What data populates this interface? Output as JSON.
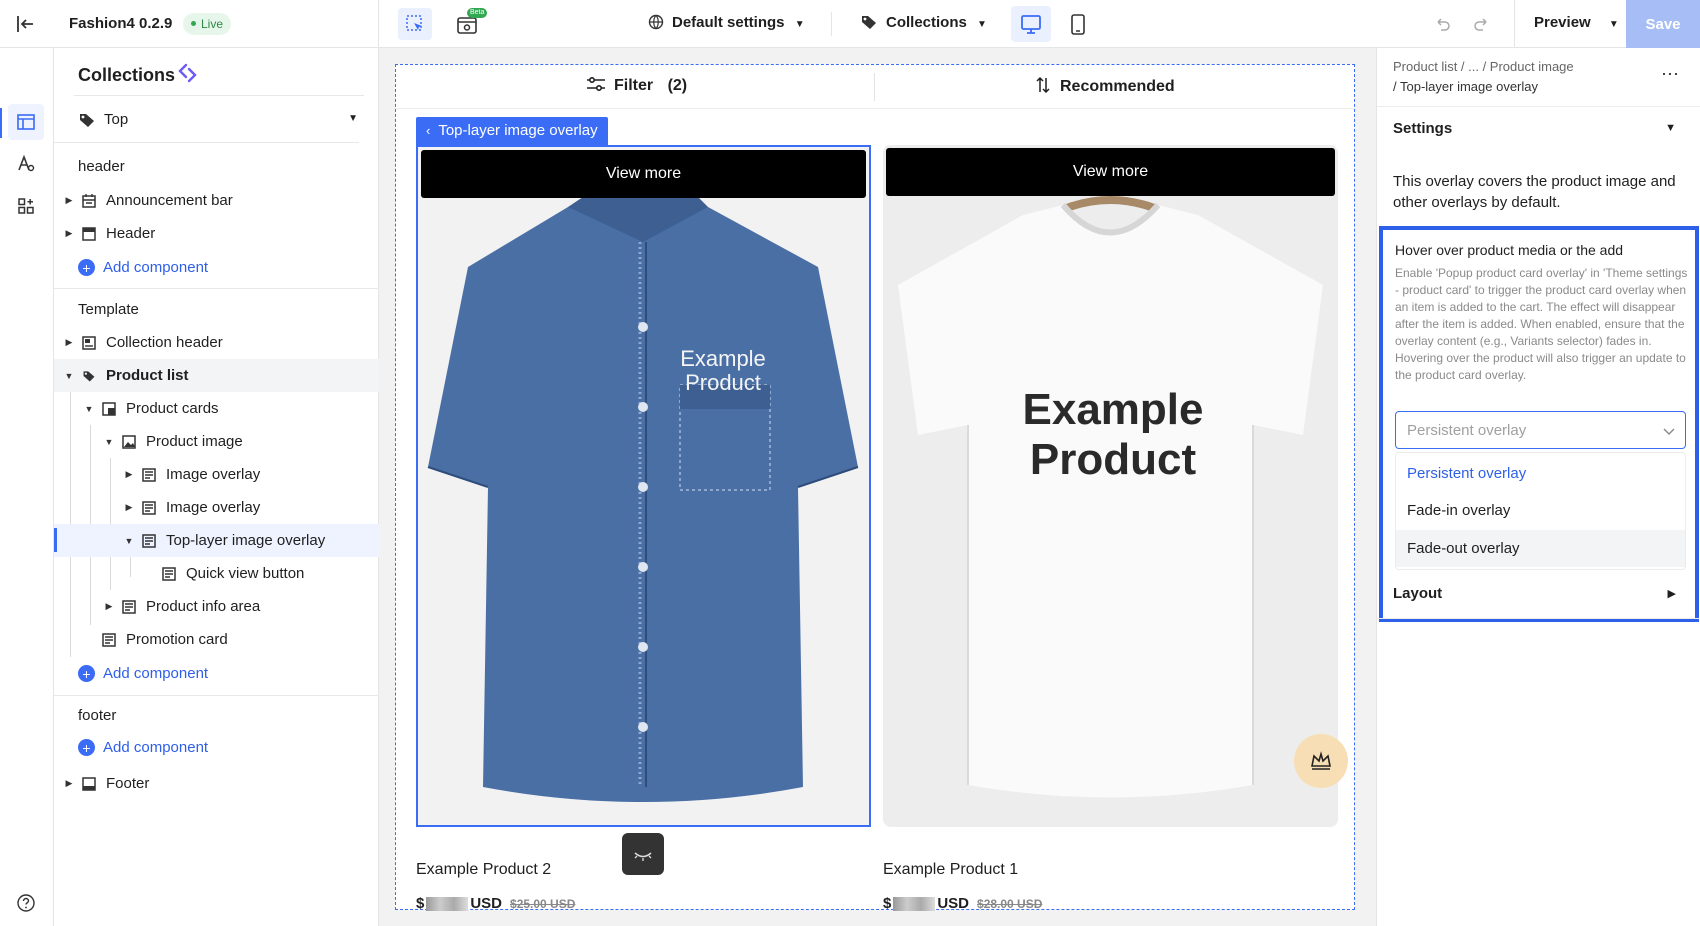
{
  "topbar": {
    "app_name": "Fashion4 0.2.9",
    "live_label": "Live",
    "beta_label": "Beta",
    "default_settings_label": "Default settings",
    "collections_label": "Collections",
    "preview_label": "Preview",
    "save_label": "Save"
  },
  "tree": {
    "title": "Collections",
    "top_select": "Top",
    "groups": {
      "header": "header",
      "template": "Template",
      "footer": "footer"
    },
    "items": {
      "announcement_bar": "Announcement bar",
      "header": "Header",
      "collection_header": "Collection header",
      "product_list": "Product list",
      "product_cards": "Product cards",
      "product_image": "Product image",
      "image_overlay_1": "Image overlay",
      "image_overlay_2": "Image overlay",
      "top_layer_overlay": "Top-layer image overlay",
      "quick_view_button": "Quick view button",
      "product_info_area": "Product info area",
      "promotion_card": "Promotion card",
      "footer": "Footer"
    },
    "add_component": "Add component"
  },
  "canvas": {
    "filter_label": "Filter",
    "filter_count": "(2)",
    "sort_label": "Recommended",
    "selected_tag": "Top-layer image overlay",
    "view_more": "View more",
    "products": [
      {
        "name": "Example Product 2",
        "price_prefix": "$",
        "currency": "USD",
        "compare": "$25.00 USD",
        "image_text": "Example Product"
      },
      {
        "name": "Example Product 1",
        "price_prefix": "$",
        "currency": "USD",
        "compare": "$28.00 USD",
        "image_text": "Example Product"
      }
    ]
  },
  "panel": {
    "breadcrumb_1": "Product list / ... / Product image",
    "breadcrumb_2": "/ Top-layer image overlay",
    "settings_label": "Settings",
    "description": "This overlay covers the product image and other overlays by default.",
    "hover_title": "Hover over product media or the add",
    "hover_desc": "Enable 'Popup product card overlay' in 'Theme settings - product card' to trigger the product card overlay when an item is added to the cart. The effect will disappear after the item is added. When enabled, ensure that the overlay content (e.g., Variants selector) fades in. Hovering over the product will also trigger an update to the product card overlay.",
    "dropdown_value": "Persistent overlay",
    "options": [
      "Persistent overlay",
      "Fade-in overlay",
      "Fade-out overlay"
    ],
    "layout_label": "Layout"
  },
  "colors": {
    "accent": "#3b6cf5",
    "save_disabled": "#a7bdf6",
    "live_green": "#33a852"
  }
}
